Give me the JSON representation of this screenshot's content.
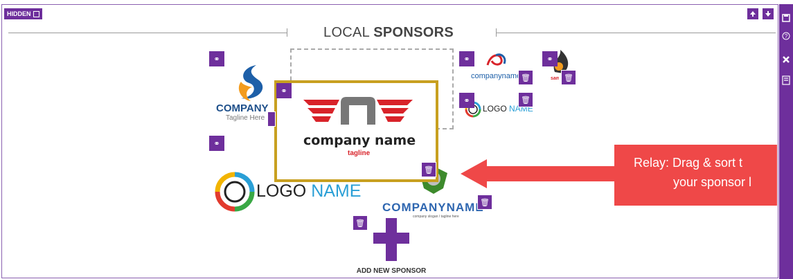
{
  "toolbar": {
    "hidden_label": "HIDDEN",
    "move_up_icon": "arrow-up",
    "move_down_icon": "arrow-down"
  },
  "section": {
    "title_light": "LOCAL",
    "title_bold": "SPONSORS"
  },
  "sponsors": {
    "logo1": {
      "word": "COMPANY",
      "tagline": "Tagline Here"
    },
    "logo2": {
      "word": "company name",
      "tagline": "tagline"
    },
    "logo3": {
      "word": "companyname"
    },
    "logo4": {
      "word": "samsi"
    },
    "logo5": {
      "part1": "LOGO",
      "part2": "NAME"
    },
    "logo6": {
      "part1": "LOGO",
      "part2": "NAME"
    },
    "logo7": {
      "word": "COMPANYNAME",
      "tagline": "company slogan / tagline here"
    }
  },
  "callout": {
    "line1": "Relay: Drag & sort t",
    "line2": "your sponsor l"
  },
  "add_button": {
    "label": "ADD NEW SPONSOR"
  },
  "colors": {
    "accent": "#6e2f9c",
    "callout": "#ef4848",
    "drag_border": "#c8a020"
  }
}
